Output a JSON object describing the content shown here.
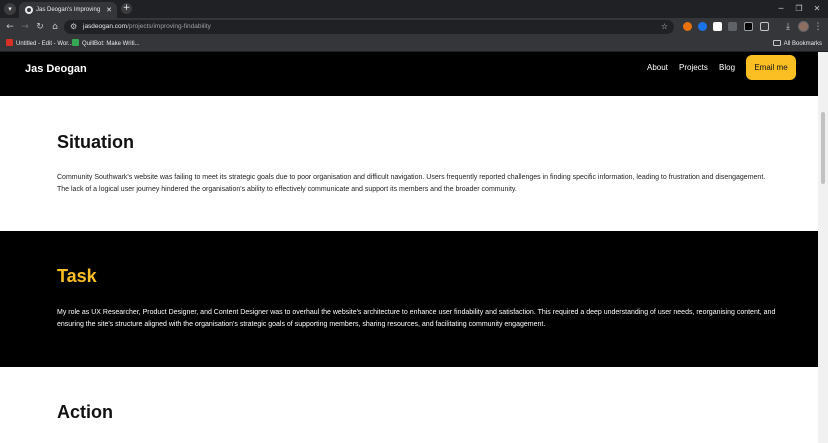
{
  "browser": {
    "tab_title": "Jas Deogan's Improving Findab",
    "url_host": "jasdeogan.com",
    "url_path": "/projects/improving-findability",
    "bookmarks": [
      {
        "label": "Untitled - Edit - Wor...",
        "color": "#d93025"
      },
      {
        "label": "QuillBot: Make Writi...",
        "color": "#34a853"
      }
    ],
    "all_bookmarks_label": "All Bookmarks"
  },
  "site": {
    "logo": "Jas Deogan",
    "nav": {
      "about": "About",
      "projects": "Projects",
      "blog": "Blog",
      "cta": "Email me"
    },
    "accent_color": "#fbbf24"
  },
  "sections": {
    "situation": {
      "heading": "Situation",
      "body": "Community Southwark's website was failing to meet its strategic goals due to poor organisation and difficult navigation. Users frequently reported challenges in finding specific information, leading to frustration and disengagement. The lack of a logical user journey hindered the organisation's ability to effectively communicate and support its members and the broader community."
    },
    "task": {
      "heading": "Task",
      "body": "My role as UX Researcher, Product Designer, and Content Designer was to overhaul the website's architecture to enhance user findability and satisfaction. This required a deep understanding of user needs, reorganising content, and ensuring the site's structure aligned with the organisation's strategic goals of supporting members, sharing resources, and facilitating community engagement."
    },
    "action": {
      "heading": "Action"
    }
  }
}
